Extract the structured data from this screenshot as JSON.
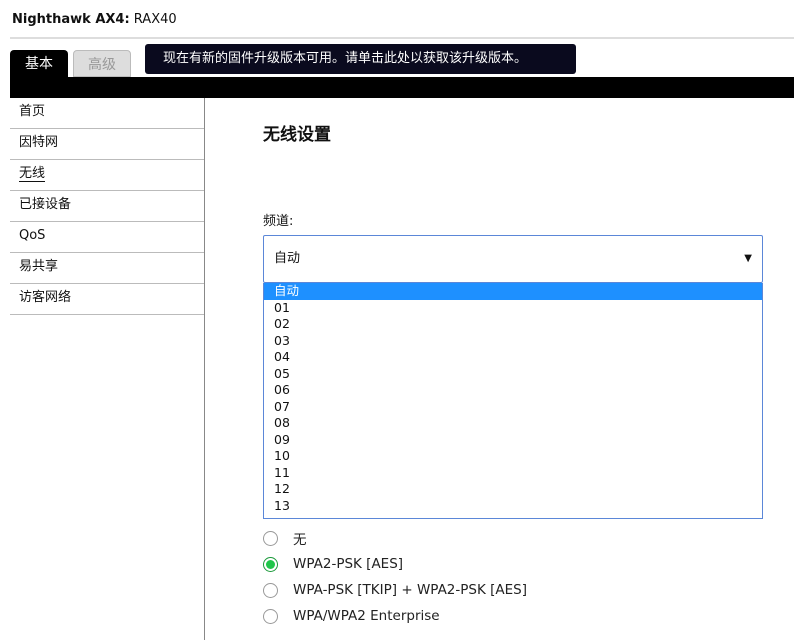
{
  "header": {
    "brand": "Nighthawk AX4:",
    "model": "RAX40"
  },
  "tabs": [
    {
      "label": "基本"
    },
    {
      "label": "高级"
    }
  ],
  "banner": "现在有新的固件升级版本可用。请单击此处以获取该升级版本。",
  "sidebar": {
    "items": [
      "首页",
      "因特网",
      "无线",
      "已接设备",
      "QoS",
      "易共享",
      "访客网络"
    ],
    "active": "无线"
  },
  "main": {
    "title": "无线设置",
    "channel_label": "频道:",
    "channel_value": "自动",
    "channel_options": [
      "自动",
      "01",
      "02",
      "03",
      "04",
      "05",
      "06",
      "07",
      "08",
      "09",
      "10",
      "11",
      "12",
      "13"
    ],
    "security_options": [
      "无",
      "WPA2-PSK [AES]",
      "WPA-PSK [TKIP] + WPA2-PSK [AES]",
      "WPA/WPA2 Enterprise"
    ],
    "security_selected": "WPA2-PSK [AES]"
  }
}
